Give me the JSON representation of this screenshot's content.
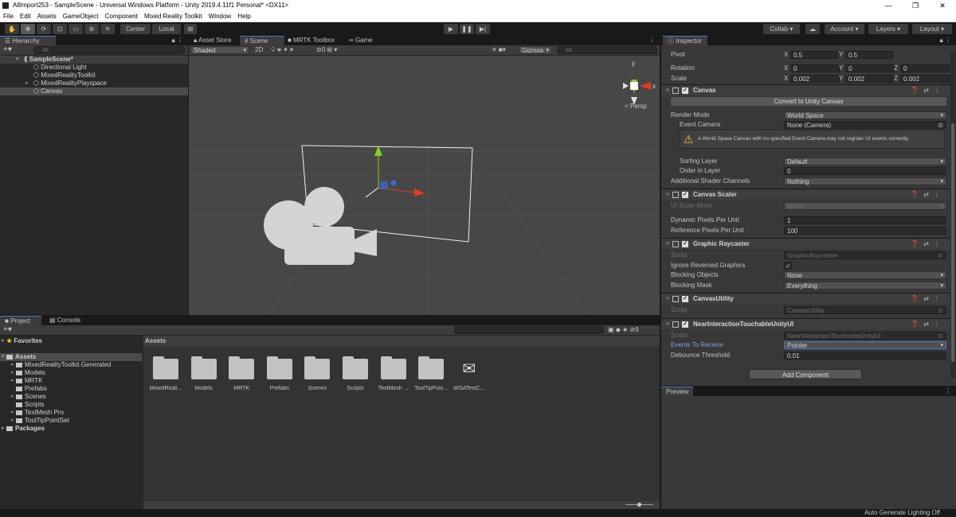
{
  "window": {
    "title": "AllImport253 - SampleScene - Universal Windows Platform - Unity 2019.4.11f1 Personal* <DX11>",
    "controls": [
      "—",
      "❐",
      "✕"
    ]
  },
  "menu": [
    "File",
    "Edit",
    "Assets",
    "GameObject",
    "Component",
    "Mixed Reality Toolkit",
    "Window",
    "Help"
  ],
  "toolbar": {
    "tools": [
      "hand",
      "move",
      "rotate",
      "scale",
      "rect",
      "transform",
      "custom"
    ],
    "center": "Center",
    "local": "Local",
    "collab": "Collab ▾",
    "account": "Account",
    "layers": "Layers",
    "layout": "Layout"
  },
  "hierarchy": {
    "tab": "Hierarchy",
    "search_placeholder": "All",
    "items": [
      {
        "label": "SampleScene*",
        "level": 0,
        "scene": true,
        "expanded": true
      },
      {
        "label": "Directional Light",
        "level": 1
      },
      {
        "label": "MixedRealityToolkit",
        "level": 1
      },
      {
        "label": "MixedRealityPlayspace",
        "level": 1,
        "collapsed": true
      },
      {
        "label": "Canvas",
        "level": 1,
        "selected": true
      }
    ]
  },
  "scene_tabs": [
    "Asset Store",
    "Scene",
    "MRTK Toolbox",
    "Game"
  ],
  "scene_toolbar": {
    "shading": "Shaded",
    "mode2d": "2D",
    "hidden_count": "0",
    "gizmos": "Gizmos",
    "search_placeholder": "All"
  },
  "scene_gizmo": {
    "y": "y",
    "x": "x",
    "projection": "Persp"
  },
  "inspector": {
    "tab": "Inspector",
    "rows": [
      {
        "type": "vec",
        "label": "Pivot",
        "axes": [
          "X",
          "Y"
        ],
        "values": [
          "0.5",
          "0.5"
        ]
      },
      {
        "type": "vec",
        "label": "Rotation",
        "axes": [
          "X",
          "Y",
          "Z"
        ],
        "values": [
          "0",
          "0",
          "0"
        ]
      },
      {
        "type": "vec",
        "label": "Scale",
        "axes": [
          "X",
          "Y",
          "Z"
        ],
        "values": [
          "0.002",
          "0.002",
          "0.002"
        ]
      },
      {
        "type": "header",
        "label": "Canvas"
      },
      {
        "type": "button",
        "label": "Convert to Unity Canvas"
      },
      {
        "type": "dd",
        "label": "Render Mode",
        "value": "World Space"
      },
      {
        "type": "obj",
        "label": "Event Camera",
        "value": "None (Camera)",
        "indent": true
      },
      {
        "type": "warn",
        "label": "A World Space Canvas with no specified Event Camera may not register UI events correctly."
      },
      {
        "type": "dd",
        "label": "Sorting Layer",
        "value": "Default",
        "indent": true
      },
      {
        "type": "field",
        "label": "Order in Layer",
        "value": "0",
        "indent": true
      },
      {
        "type": "dd",
        "label": "Additional Shader Channels",
        "value": "Nothing"
      },
      {
        "type": "header",
        "label": "Canvas Scaler"
      },
      {
        "type": "dd",
        "label": "UI Scale Mode",
        "value": "World",
        "disabled": true
      },
      {
        "type": "field",
        "label": "Dynamic Pixels Per Unit",
        "value": "1"
      },
      {
        "type": "field",
        "label": "Reference Pixels Per Unit",
        "value": "100"
      },
      {
        "type": "header",
        "label": "Graphic Raycaster"
      },
      {
        "type": "obj",
        "label": "Script",
        "value": "GraphicRaycaster",
        "disabled": true
      },
      {
        "type": "check",
        "label": "Ignore Reversed Graphics",
        "value": "✓"
      },
      {
        "type": "dd",
        "label": "Blocking Objects",
        "value": "None"
      },
      {
        "type": "dd",
        "label": "Blocking Mask",
        "value": "Everything"
      },
      {
        "type": "header",
        "label": "CanvasUtility"
      },
      {
        "type": "obj",
        "label": "Script",
        "value": "CanvasUtility",
        "disabled": true
      },
      {
        "type": "header",
        "label": "NearInteractionTouchableUnityUI"
      },
      {
        "type": "obj",
        "label": "Script",
        "value": "NearInteractionTouchableUnityUI",
        "disabled": true
      },
      {
        "type": "dd",
        "label": "Events To Receive",
        "value": "Pointer",
        "highlight": true
      },
      {
        "type": "field",
        "label": "Debounce Threshold",
        "value": "0.01"
      }
    ],
    "add_component": "Add Component"
  },
  "preview": {
    "tab": "Preview"
  },
  "project": {
    "tabs": [
      "Project",
      "Console"
    ],
    "tree": [
      {
        "label": "Favorites",
        "level": 0,
        "star": true
      },
      {
        "label": "Assets",
        "level": 0,
        "selected": true,
        "expanded": true
      },
      {
        "label": "MixedRealityToolkit.Generated",
        "level": 1,
        "arrow": true
      },
      {
        "label": "Models",
        "level": 1,
        "arrow": true
      },
      {
        "label": "MRTK",
        "level": 1,
        "arrow": true
      },
      {
        "label": "Prefabs",
        "level": 1
      },
      {
        "label": "Scenes",
        "level": 1,
        "arrow": true
      },
      {
        "label": "Scripts",
        "level": 1
      },
      {
        "label": "TextMesh Pro",
        "level": 1,
        "arrow": true
      },
      {
        "label": "ToolTipPointSet",
        "level": 1,
        "arrow": true
      },
      {
        "label": "Packages",
        "level": 0,
        "arrow": true
      }
    ],
    "breadcrumb": "Assets",
    "hidden_count": "9",
    "assets": [
      "MixedReali...",
      "Models",
      "MRTK",
      "Prefabs",
      "Scenes",
      "Scripts",
      "TextMesh ...",
      "ToolTipPoin...",
      "WSATestC..."
    ]
  },
  "status": {
    "text": "Auto Generate Lighting Off"
  },
  "colors": {
    "accent": "#4a7cc7",
    "panel": "#282828",
    "header": "#3e3e3e",
    "scene_bg": "#474747"
  }
}
